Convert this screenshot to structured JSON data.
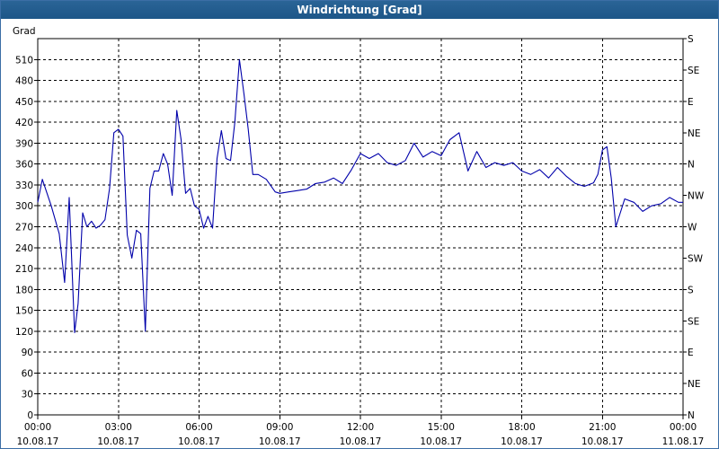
{
  "window": {
    "title": "Windrichtung [Grad]"
  },
  "chart_data": {
    "type": "line",
    "title": "Windrichtung [Grad]",
    "ylabel": "Grad",
    "ylim": [
      0,
      540
    ],
    "y_ticks": [
      0,
      30,
      60,
      90,
      120,
      150,
      180,
      210,
      240,
      270,
      300,
      330,
      360,
      390,
      420,
      450,
      480,
      510
    ],
    "y2_ticks": [
      "N",
      "NE",
      "E",
      "SE",
      "S",
      "SW",
      "W",
      "NW",
      "N",
      "NE",
      "E",
      "SE",
      "S"
    ],
    "x_range_hours": [
      0,
      24
    ],
    "x_ticks": [
      {
        "time": "00:00",
        "date": "10.08.17"
      },
      {
        "time": "03:00",
        "date": "10.08.17"
      },
      {
        "time": "06:00",
        "date": "10.08.17"
      },
      {
        "time": "09:00",
        "date": "10.08.17"
      },
      {
        "time": "12:00",
        "date": "10.08.17"
      },
      {
        "time": "15:00",
        "date": "10.08.17"
      },
      {
        "time": "18:00",
        "date": "10.08.17"
      },
      {
        "time": "21:00",
        "date": "10.08.17"
      },
      {
        "time": "00:00",
        "date": "11.08.17"
      }
    ],
    "grid": true,
    "line_color": "#0000aa",
    "series": [
      {
        "x": [
          0,
          0.17,
          0.5,
          0.8,
          1.0,
          1.17,
          1.37,
          1.5,
          1.67,
          1.83,
          2.0,
          2.17,
          2.33,
          2.5,
          2.67,
          2.83,
          3.0,
          3.17,
          3.33,
          3.5,
          3.67,
          3.83,
          4.0,
          4.17,
          4.33,
          4.5,
          4.67,
          4.83,
          5.0,
          5.17,
          5.33,
          5.5,
          5.67,
          5.83,
          6.0,
          6.17,
          6.33,
          6.5,
          6.67,
          6.83,
          7.0,
          7.17,
          7.33,
          7.5,
          7.67,
          7.83,
          8.0,
          8.2,
          8.5,
          8.83,
          9.0,
          9.33,
          9.67,
          10.0,
          10.33,
          10.67,
          11.0,
          11.33,
          11.67,
          12.0,
          12.33,
          12.67,
          13.0,
          13.33,
          13.67,
          14.0,
          14.33,
          14.67,
          15.0,
          15.33,
          15.67,
          16.0,
          16.33,
          16.67,
          17.0,
          17.33,
          17.67,
          18.0,
          18.33,
          18.67,
          19.0,
          19.33,
          19.67,
          20.0,
          20.33,
          20.67,
          20.83,
          21.0,
          21.17,
          21.33,
          21.5,
          21.83,
          22.17,
          22.5,
          22.83,
          23.17,
          23.5,
          23.83,
          24.0
        ],
        "y": [
          305,
          338,
          300,
          260,
          190,
          312,
          118,
          160,
          290,
          270,
          278,
          268,
          272,
          280,
          325,
          405,
          410,
          400,
          258,
          225,
          265,
          260,
          120,
          325,
          350,
          350,
          375,
          360,
          315,
          437,
          395,
          318,
          325,
          300,
          295,
          268,
          285,
          268,
          368,
          408,
          368,
          365,
          420,
          510,
          460,
          410,
          345,
          345,
          338,
          320,
          318,
          320,
          322,
          324,
          332,
          334,
          340,
          332,
          352,
          375,
          368,
          375,
          362,
          358,
          365,
          390,
          370,
          378,
          372,
          395,
          405,
          350,
          378,
          355,
          362,
          358,
          362,
          350,
          345,
          352,
          340,
          355,
          342,
          332,
          328,
          333,
          345,
          380,
          385,
          340,
          270,
          310,
          305,
          292,
          300,
          303,
          312,
          305,
          305
        ]
      }
    ]
  }
}
